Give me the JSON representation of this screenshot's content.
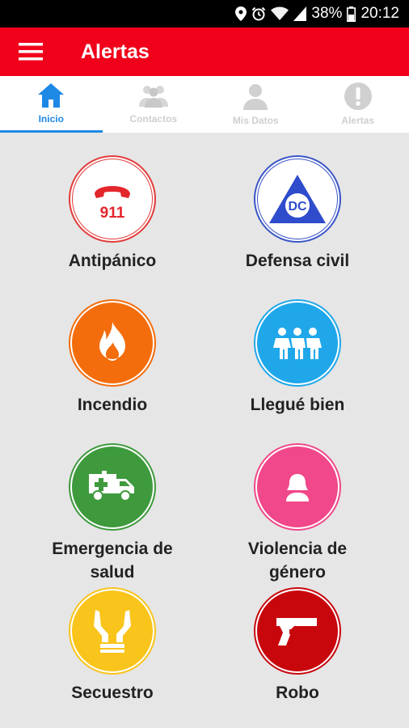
{
  "status_bar": {
    "battery_percent": "38%",
    "time": "20:12"
  },
  "app_bar": {
    "title": "Alertas",
    "color": "#f0001b"
  },
  "tabs": [
    {
      "label": "Inicio",
      "icon": "home-icon",
      "active": true
    },
    {
      "label": "Contactos",
      "icon": "contacts-icon",
      "active": false
    },
    {
      "label": "Mis Datos",
      "icon": "person-icon",
      "active": false
    },
    {
      "label": "Alertas",
      "icon": "exclamation-icon",
      "active": false
    }
  ],
  "alerts": [
    {
      "label": "Antipánico",
      "icon": "phone-911-icon",
      "badge": "911",
      "color": "#ffffff",
      "ring": "#e23b3b"
    },
    {
      "label": "Defensa civil",
      "icon": "civil-defense-icon",
      "badge": "DC",
      "color": "#ffffff",
      "ring": "#3a55c8"
    },
    {
      "label": "Incendio",
      "icon": "fire-icon",
      "color": "#f36d0c",
      "ring": "#f36d0c"
    },
    {
      "label": "Llegué bien",
      "icon": "family-icon",
      "color": "#1fa7ea",
      "ring": "#1fa7ea"
    },
    {
      "label": "Emergencia de salud",
      "icon": "ambulance-icon",
      "color": "#3e9a3d",
      "ring": "#3e9a3d"
    },
    {
      "label": "Violencia de género",
      "icon": "woman-icon",
      "color": "#f0488a",
      "ring": "#f0488a"
    },
    {
      "label": "Secuestro",
      "icon": "hands-icon",
      "color": "#f9c41b",
      "ring": "#f9c41b"
    },
    {
      "label": "Robo",
      "icon": "gun-icon",
      "color": "#c8070d",
      "ring": "#c8070d"
    }
  ]
}
